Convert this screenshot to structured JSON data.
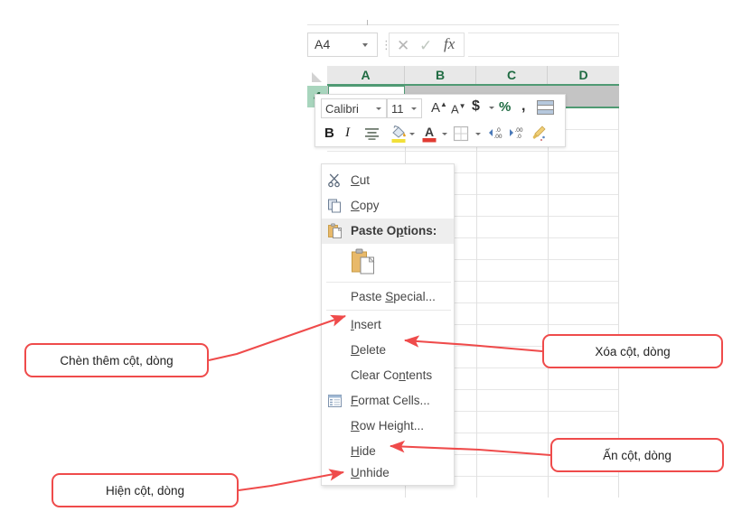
{
  "app": "Microsoft Excel",
  "formula_bar": {
    "name_box_value": "A4",
    "name_box_dropdown_icon": "chevron-down-icon",
    "cancel_icon": "cancel-x-icon",
    "enter_icon": "confirm-check-icon",
    "function_icon": "insert-function-fx-icon",
    "formula_value": "",
    "formula_placeholder": ""
  },
  "grid": {
    "columns": [
      "A",
      "B",
      "C",
      "D"
    ],
    "selected_row": "4",
    "active_cell": "A4",
    "header_text_color": "#1f6b42",
    "selection_fill": "#c4c4c4",
    "row_header_fill": "#a8d5bd"
  },
  "mini_toolbar": {
    "font_name": "Calibri",
    "font_size": "11",
    "grow_font_label": "A",
    "shrink_font_label": "A",
    "currency_label": "$",
    "percent_label": "%",
    "comma_label": ",",
    "conditional_format_icon": "conditional-formatting-icon",
    "bold_label": "B",
    "italic_label": "I",
    "align_icon": "align-center-icon",
    "fill_color_icon": "fill-color-icon",
    "font_color_icon": "font-color-icon",
    "borders_icon": "borders-icon",
    "increase_decimal_icon": "increase-decimal-icon",
    "decrease_decimal_icon": "decrease-decimal-icon",
    "format_painter_icon": "format-painter-icon"
  },
  "context_menu": {
    "items": [
      {
        "id": "cut",
        "label": "Cut",
        "icon": "scissors-icon",
        "accel_index": 2,
        "highlighted": false,
        "bold": false
      },
      {
        "id": "copy",
        "label": "Copy",
        "icon": "copy-pages-icon",
        "accel_index": 0,
        "highlighted": false,
        "bold": false
      },
      {
        "id": "paste-options",
        "label": "Paste Options:",
        "icon": "clipboard-icon",
        "accel_index": 8,
        "highlighted": true,
        "bold": true
      },
      {
        "id": "paste-keep-formatting",
        "label": "",
        "icon": "clipboard-paste-large-icon",
        "accel_index": -1,
        "highlighted": false,
        "bold": false
      },
      {
        "id": "paste-special",
        "label": "Paste Special...",
        "icon": "",
        "accel_index": 6,
        "highlighted": false,
        "bold": false
      },
      {
        "id": "insert",
        "label": "Insert",
        "icon": "",
        "accel_index": 0,
        "highlighted": false,
        "bold": false
      },
      {
        "id": "delete",
        "label": "Delete",
        "icon": "",
        "accel_index": 0,
        "highlighted": false,
        "bold": false
      },
      {
        "id": "clear-contents",
        "label": "Clear Contents",
        "icon": "",
        "accel_index": 8,
        "highlighted": false,
        "bold": false
      },
      {
        "id": "format-cells",
        "label": "Format Cells...",
        "icon": "format-cells-icon",
        "accel_index": 0,
        "highlighted": false,
        "bold": false
      },
      {
        "id": "row-height",
        "label": "Row Height...",
        "icon": "",
        "accel_index": 0,
        "highlighted": false,
        "bold": false
      },
      {
        "id": "hide",
        "label": "Hide",
        "icon": "",
        "accel_index": 0,
        "highlighted": false,
        "bold": false
      },
      {
        "id": "unhide",
        "label": "Unhide",
        "icon": "",
        "accel_index": 0,
        "highlighted": false,
        "bold": false
      }
    ]
  },
  "annotations": {
    "accent_color": "#ef4b4b",
    "callouts": [
      {
        "id": "insert",
        "text": "Chèn thêm cột, dòng",
        "points_to": "insert"
      },
      {
        "id": "delete",
        "text": "Xóa cột, dòng",
        "points_to": "delete"
      },
      {
        "id": "hide",
        "text": "Ấn cột, dòng",
        "points_to": "hide"
      },
      {
        "id": "unhide",
        "text": "Hiện cột, dòng",
        "points_to": "unhide"
      }
    ]
  }
}
